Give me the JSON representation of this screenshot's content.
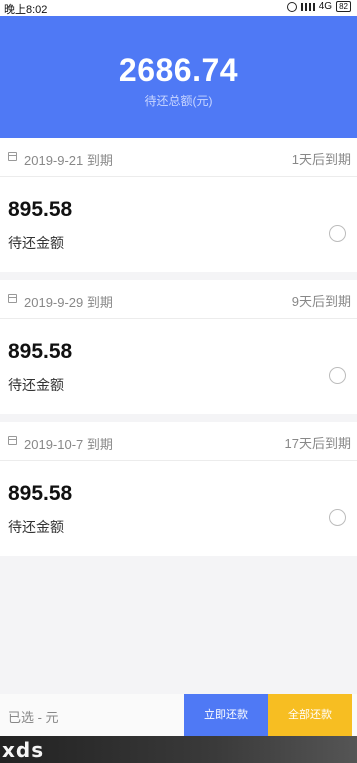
{
  "status_bar": {
    "time": "晚上8:02",
    "network": "4G",
    "battery": "82",
    "icons": [
      "alarm-icon",
      "signal-icon",
      "battery-icon"
    ]
  },
  "header": {
    "total_amount": "2686.74",
    "total_label": "待还总额(元)"
  },
  "bills": [
    {
      "due_date": "2019-9-21 到期",
      "days_left": "1天后到期",
      "amount": "895.58",
      "amount_label": "待还金额"
    },
    {
      "due_date": "2019-9-29 到期",
      "days_left": "9天后到期",
      "amount": "895.58",
      "amount_label": "待还金额"
    },
    {
      "due_date": "2019-10-7 到期",
      "days_left": "17天后到期",
      "amount": "895.58",
      "amount_label": "待还金额"
    }
  ],
  "footer": {
    "selected_text": "已选 - 元",
    "pay_now_label": "立即还款",
    "pay_all_label": "全部还款"
  },
  "watermark": {
    "text": "xds"
  },
  "colors": {
    "header_blue": "#4f79f5",
    "pay_now_blue": "#4f79f5",
    "pay_all_yellow": "#f7be22",
    "background": "#f4f4f6"
  }
}
